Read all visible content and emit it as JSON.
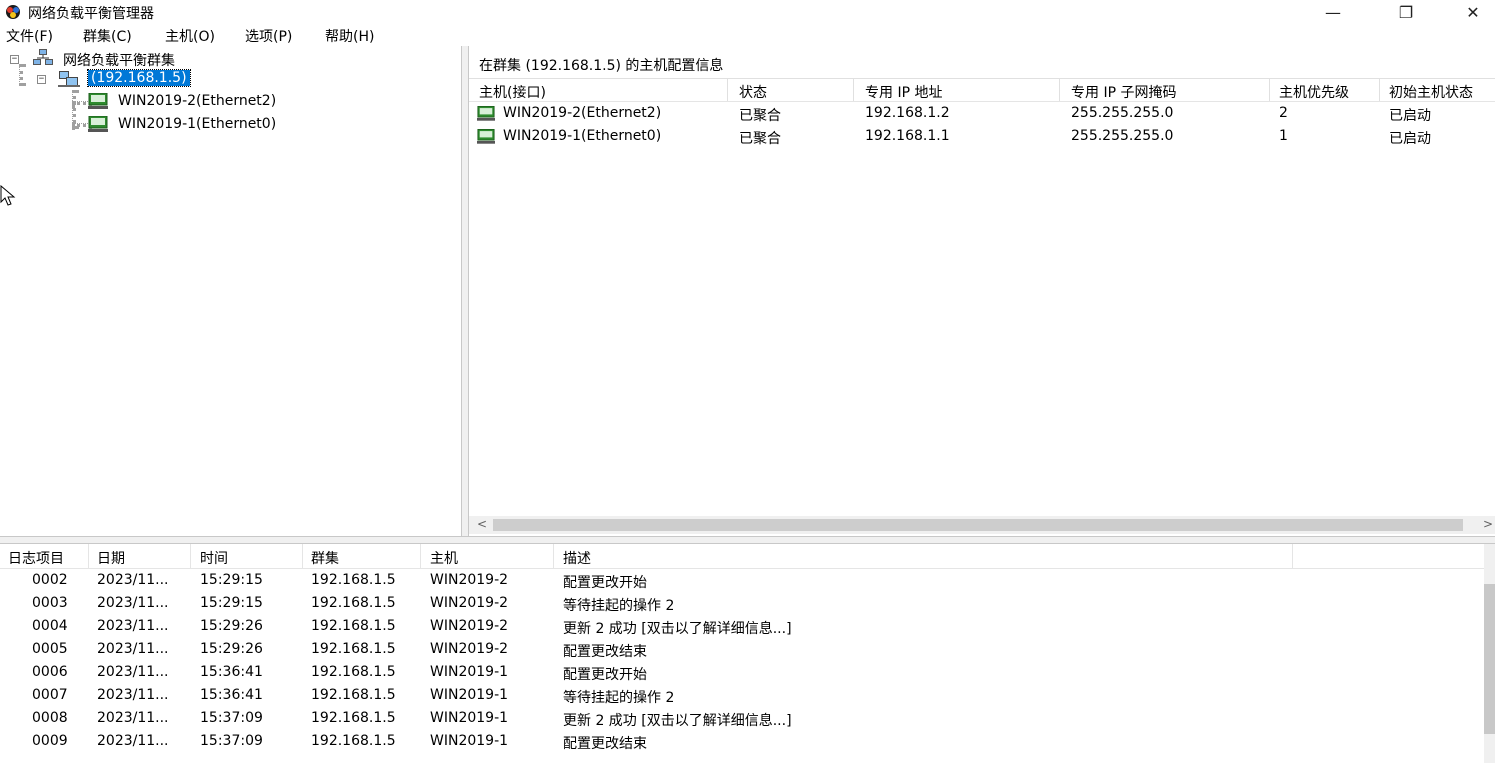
{
  "window": {
    "title": "网络负载平衡管理器",
    "minimize_glyph": "—",
    "restore_glyph": "❐",
    "close_glyph": "✕"
  },
  "menu": {
    "items": [
      {
        "label": "文件(F)"
      },
      {
        "label": "群集(C)"
      },
      {
        "label": "主机(O)"
      },
      {
        "label": "选项(P)"
      },
      {
        "label": "帮助(H)"
      }
    ]
  },
  "tree": {
    "root_label": "网络负载平衡群集",
    "cluster_label": "(192.168.1.5)",
    "hosts": [
      {
        "label": "WIN2019-2(Ethernet2)"
      },
      {
        "label": "WIN2019-1(Ethernet0)"
      }
    ],
    "expander_glyph": "−"
  },
  "hosts_panel": {
    "caption": "在群集  (192.168.1.5) 的主机配置信息",
    "columns": [
      "主机(接口)",
      "状态",
      "专用 IP 地址",
      "专用 IP 子网掩码",
      "主机优先级",
      "初始主机状态"
    ],
    "rows": [
      {
        "host": "WIN2019-2(Ethernet2)",
        "status": "已聚合",
        "ip": "192.168.1.2",
        "mask": "255.255.255.0",
        "priority": "2",
        "initial": "已启动"
      },
      {
        "host": "WIN2019-1(Ethernet0)",
        "status": "已聚合",
        "ip": "192.168.1.1",
        "mask": "255.255.255.0",
        "priority": "1",
        "initial": "已启动"
      }
    ],
    "scroll_left_glyph": "<",
    "scroll_right_glyph": ">"
  },
  "log": {
    "columns": [
      "日志项目",
      "日期",
      "时间",
      "群集",
      "主机",
      "描述"
    ],
    "rows": [
      {
        "id": "0002",
        "date": "2023/11...",
        "time": "15:29:15",
        "cluster": "192.168.1.5",
        "host": "WIN2019-2",
        "desc": "配置更改开始"
      },
      {
        "id": "0003",
        "date": "2023/11...",
        "time": "15:29:15",
        "cluster": "192.168.1.5",
        "host": "WIN2019-2",
        "desc": "等待挂起的操作 2"
      },
      {
        "id": "0004",
        "date": "2023/11...",
        "time": "15:29:26",
        "cluster": "192.168.1.5",
        "host": "WIN2019-2",
        "desc": "更新 2 成功 [双击以了解详细信息...]"
      },
      {
        "id": "0005",
        "date": "2023/11...",
        "time": "15:29:26",
        "cluster": "192.168.1.5",
        "host": "WIN2019-2",
        "desc": "配置更改结束"
      },
      {
        "id": "0006",
        "date": "2023/11...",
        "time": "15:36:41",
        "cluster": "192.168.1.5",
        "host": "WIN2019-1",
        "desc": "配置更改开始"
      },
      {
        "id": "0007",
        "date": "2023/11...",
        "time": "15:36:41",
        "cluster": "192.168.1.5",
        "host": "WIN2019-1",
        "desc": "等待挂起的操作 2"
      },
      {
        "id": "0008",
        "date": "2023/11...",
        "time": "15:37:09",
        "cluster": "192.168.1.5",
        "host": "WIN2019-1",
        "desc": "更新 2 成功 [双击以了解详细信息...]"
      },
      {
        "id": "0009",
        "date": "2023/11...",
        "time": "15:37:09",
        "cluster": "192.168.1.5",
        "host": "WIN2019-1",
        "desc": "配置更改结束"
      }
    ]
  },
  "colors": {
    "selection": "#0078d7",
    "host_icon_green": "#2e8b2e"
  }
}
